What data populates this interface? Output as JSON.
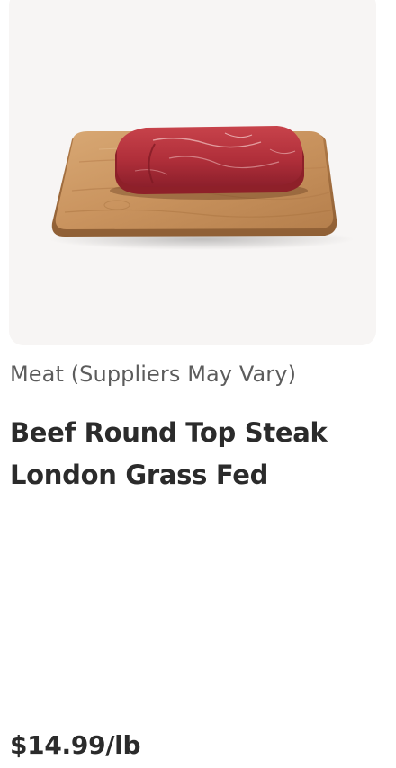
{
  "product": {
    "image_alt": "Beef round top steak on a wooden cutting board",
    "supplier": "Meat (Suppliers May Vary)",
    "name": "Beef Round Top Steak London Grass Fed",
    "price": "$14.99/lb"
  },
  "colors": {
    "image_background": "#f7f5f4",
    "text_primary": "#2b2b2b",
    "text_secondary": "#5c5c5c"
  }
}
